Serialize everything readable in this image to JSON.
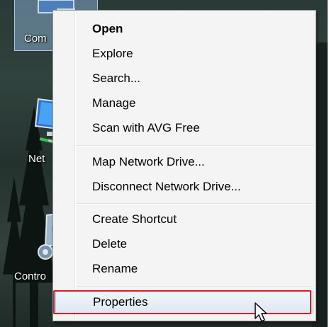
{
  "desktop": {
    "icons": [
      {
        "label": "Com"
      },
      {
        "label": "Net"
      },
      {
        "label": "Contro"
      }
    ]
  },
  "context_menu": {
    "items": [
      {
        "label": "Open"
      },
      {
        "label": "Explore"
      },
      {
        "label": "Search..."
      },
      {
        "label": "Manage"
      },
      {
        "label": "Scan with AVG Free"
      },
      {
        "label": "Map Network Drive..."
      },
      {
        "label": "Disconnect Network Drive..."
      },
      {
        "label": "Create Shortcut"
      },
      {
        "label": "Delete"
      },
      {
        "label": "Rename"
      },
      {
        "label": "Properties"
      }
    ],
    "hovered_item": "Properties"
  },
  "colors": {
    "highlight_box": "#e01a22",
    "menu_background": "#f4f4f4",
    "hover_border": "#a8c8e8"
  },
  "icons": {
    "computer": "computer-icon",
    "network": "network-icon",
    "control_panel": "control-panel-icon",
    "cursor": "arrow-cursor-icon"
  }
}
